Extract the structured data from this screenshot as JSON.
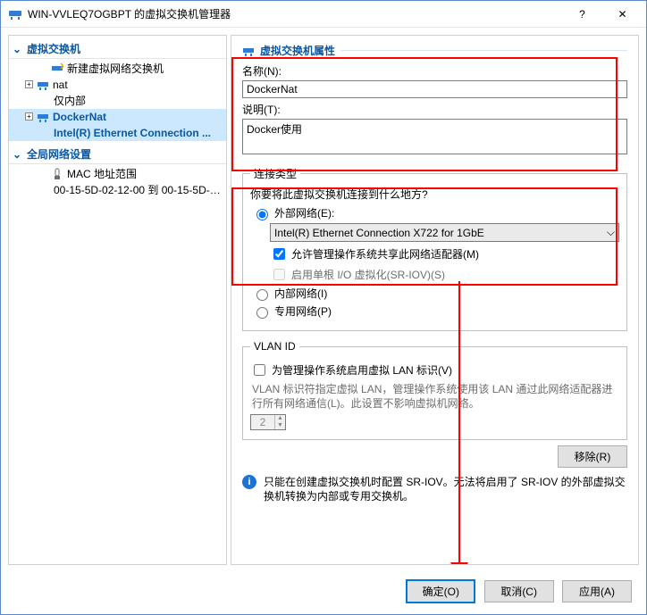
{
  "window": {
    "title": "WIN-VVLEQ7OGBPT 的虚拟交换机管理器"
  },
  "titlebar_buttons": {
    "help": "?",
    "close": "✕"
  },
  "tree": {
    "section1": "虚拟交换机",
    "new_switch": "新建虚拟网络交换机",
    "nat": "nat",
    "nat_sub": "仅内部",
    "dockernat": "DockerNat",
    "dockernat_sub": "Intel(R) Ethernet Connection ...",
    "section2": "全局网络设置",
    "mac": "MAC 地址范围",
    "mac_sub": "00-15-5D-02-12-00 到 00-15-5D-0..."
  },
  "panel": {
    "title": "虚拟交换机属性",
    "name_label": "名称(N):",
    "name_value": "DockerNat",
    "desc_label": "说明(T):",
    "desc_value": "Docker使用"
  },
  "conn": {
    "legend": "连接类型",
    "question": "你要将此虚拟交换机连接到什么地方?",
    "external": "外部网络(E):",
    "adapter": "Intel(R) Ethernet Connection X722 for 1GbE",
    "allow_mgmt": "允许管理操作系统共享此网络适配器(M)",
    "sriov": "启用单根 I/O 虚拟化(SR-IOV)(S)",
    "internal": "内部网络(I)",
    "private": "专用网络(P)"
  },
  "vlan": {
    "legend": "VLAN ID",
    "chk": "为管理操作系统启用虚拟 LAN 标识(V)",
    "hint": "VLAN 标识符指定虚拟 LAN，管理操作系统使用该 LAN 通过此网络适配器进行所有网络通信(L)。此设置不影响虚拟机网络。",
    "value": "2"
  },
  "remove": "移除(R)",
  "info": "只能在创建虚拟交换机时配置 SR-IOV。无法将启用了 SR-IOV 的外部虚拟交换机转换为内部或专用交换机。",
  "footer": {
    "ok": "确定(O)",
    "cancel": "取消(C)",
    "apply": "应用(A)"
  }
}
